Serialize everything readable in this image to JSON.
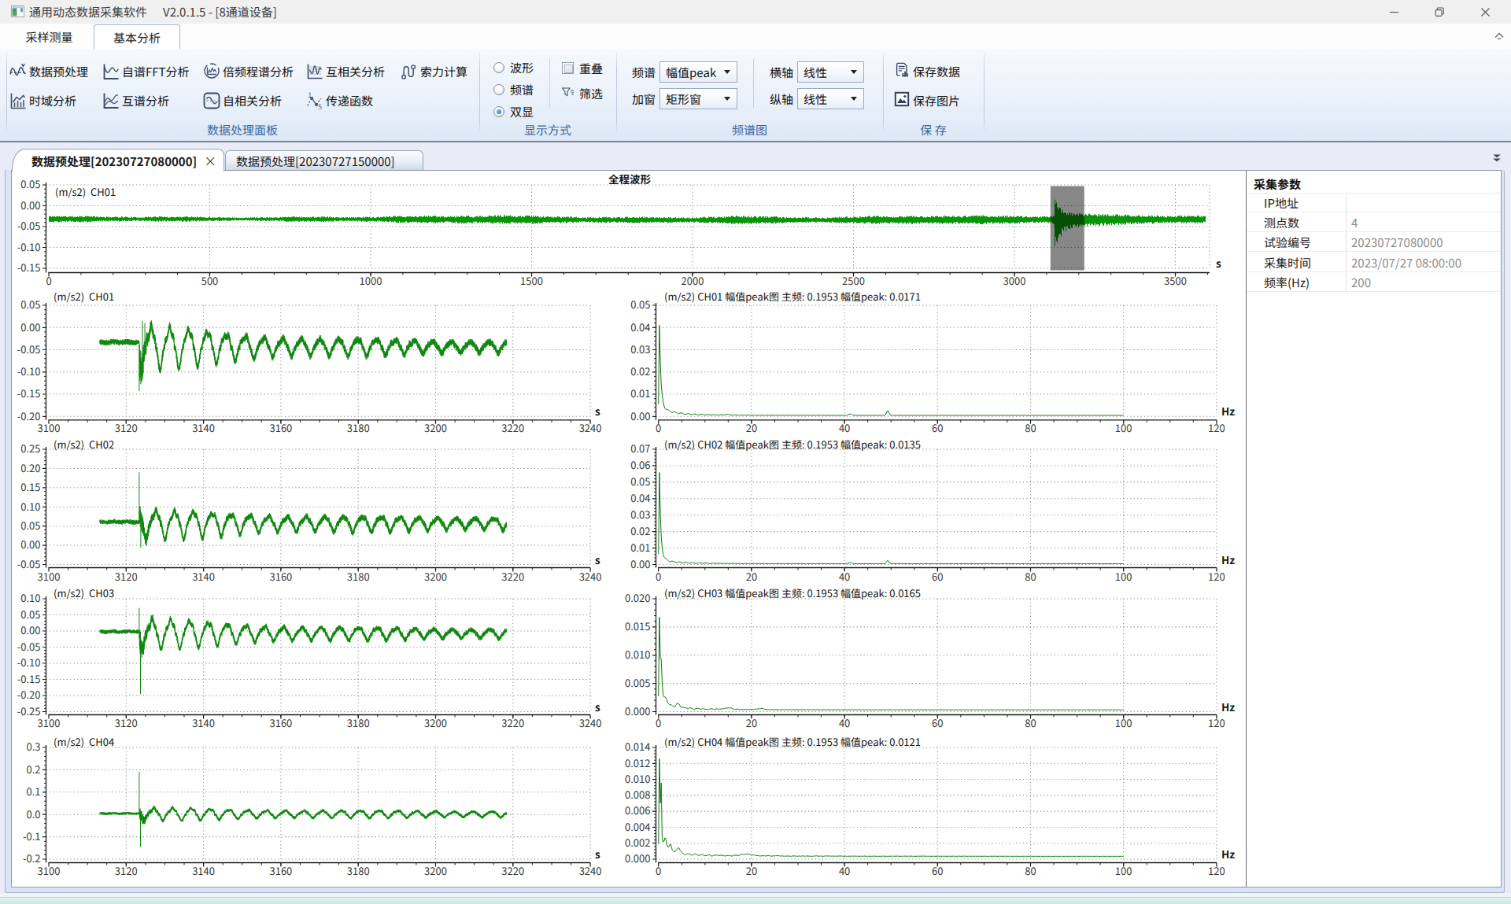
{
  "window": {
    "icon": "app-window-icon",
    "title": "通用动态数据采集软件",
    "version": "V2.0.1.5 - [8通道设备]",
    "buttons": [
      "minimize",
      "restore",
      "close"
    ]
  },
  "ribbon": {
    "tabs": [
      {
        "label": "采样测量",
        "active": false
      },
      {
        "label": "基本分析",
        "active": true
      }
    ],
    "groups": [
      {
        "label": "数据处理面板",
        "buttons": [
          {
            "id": "preprocess",
            "icon": "wave-check-icon",
            "label": "数据预处理"
          },
          {
            "id": "fft",
            "icon": "spectrum-curve-icon",
            "label": "自谱FFT分析"
          },
          {
            "id": "octave",
            "icon": "circle-histogram-icon",
            "label": "倍频程谱分析"
          },
          {
            "id": "xcorr",
            "icon": "dual-wave-chart-icon",
            "label": "互相关分析"
          },
          {
            "id": "cable-force",
            "icon": "rope-ends-icon",
            "label": "索力计算"
          },
          {
            "id": "time-domain",
            "icon": "bar-line-chart-icon",
            "label": "时域分析"
          },
          {
            "id": "cross-spectrum",
            "icon": "two-curves-icon",
            "label": "互谱分析"
          },
          {
            "id": "autocorr",
            "icon": "boxed-wave-icon",
            "label": "自相关分析"
          },
          {
            "id": "transfer-fn",
            "icon": "node-zigzag-icon",
            "label": "传递函数"
          }
        ]
      },
      {
        "label": "显示方式",
        "radios": [
          {
            "label": "波形",
            "checked": false
          },
          {
            "label": "频谱",
            "checked": false
          },
          {
            "label": "双显",
            "checked": true
          }
        ],
        "checkbox": {
          "label": "重叠",
          "checked": false
        },
        "filter": {
          "label": "筛选",
          "icon": "funnel-icon"
        }
      },
      {
        "label": "频谱图",
        "fields": [
          {
            "label": "频谱",
            "value": "幅值peak"
          },
          {
            "label": "加窗",
            "value": "矩形窗"
          },
          {
            "label": "横轴",
            "value": "线性"
          },
          {
            "label": "纵轴",
            "value": "线性"
          }
        ]
      },
      {
        "label": "保 存",
        "buttons": [
          {
            "id": "save-data",
            "icon": "document-chart-icon",
            "label": "保存数据"
          },
          {
            "id": "save-image",
            "icon": "picture-icon",
            "label": "保存图片"
          }
        ]
      }
    ]
  },
  "doc_tabs": [
    {
      "label": "数据预处理[20230727080000]",
      "active": true,
      "close": "×"
    },
    {
      "label": "数据预处理[20230727150000]",
      "active": false
    }
  ],
  "params": {
    "title": "采集参数",
    "rows": [
      {
        "label": "IP地址",
        "value": ""
      },
      {
        "label": "测点数",
        "value": "4"
      },
      {
        "label": "试验编号",
        "value": "20230727080000"
      },
      {
        "label": "采集时间",
        "value": "2023/07/27 08:00:00"
      },
      {
        "label": "频率(Hz)",
        "value": "200"
      }
    ]
  },
  "chart_data": {
    "overview": {
      "type": "line",
      "title": "全程波形",
      "unit": "(m/s2)",
      "channel": "CH01",
      "xlabel": "s",
      "x_ticks": [
        "0",
        "500",
        "1000",
        "1500",
        "2000",
        "2500",
        "3000",
        "3500"
      ],
      "x_tick_values": [
        0,
        500,
        1000,
        1500,
        2000,
        2500,
        3000,
        3500
      ],
      "y_ticks": [
        "0.05",
        "0.00",
        "-0.05",
        "-0.10",
        "-0.15"
      ],
      "y_tick_values": [
        0.05,
        0.0,
        -0.05,
        -0.1,
        -0.15
      ],
      "x_range_data": [
        0,
        3592
      ],
      "selection": [
        3112,
        3217
      ],
      "signal": {
        "seed": 11,
        "base": -0.033,
        "noise": 0.005,
        "event_t": 3122.5,
        "event_amp": 0.053,
        "event_tau": 21,
        "post_amp": 0.009,
        "post_tau": 320,
        "bumps": [
          {
            "t": 2130,
            "a": 0.0032,
            "w": 110
          },
          {
            "t": 1350,
            "a": 0.0018,
            "w": 140
          },
          {
            "t": 2750,
            "a": 0.0015,
            "w": 90
          }
        ]
      }
    },
    "time_series": [
      {
        "type": "line",
        "unit": "(m/s2)",
        "channel": "CH01",
        "xlabel": "s",
        "x_ticks": [
          "3100",
          "3120",
          "3140",
          "3160",
          "3180",
          "3200",
          "3220",
          "3240"
        ],
        "x_tick_values": [
          3100,
          3120,
          3140,
          3160,
          3180,
          3200,
          3220,
          3240
        ],
        "y_ticks": [
          "0.05",
          "0.00",
          "-0.05",
          "-0.10",
          "-0.15",
          "-0.20"
        ],
        "y_tick_values": [
          0.05,
          0.0,
          -0.05,
          -0.1,
          -0.15,
          -0.2
        ],
        "signal": {
          "seed": 21,
          "base": -0.033,
          "mid": -0.0435,
          "noise_pre": 0.0052,
          "noise_post": 0.0062,
          "burst": 0.03,
          "up0": 0.027,
          "up1": 0.0095,
          "tau": 38,
          "asym": 1.32,
          "freq": 0.206,
          "phi": 2.4,
          "spikes": [
            [
              0.0,
              -0.143
            ],
            [
              0.85,
              0.015
            ],
            [
              1.45,
              0.01
            ]
          ]
        }
      },
      {
        "type": "line",
        "unit": "(m/s2)",
        "channel": "CH02",
        "xlabel": "s",
        "x_ticks": [
          "3100",
          "3120",
          "3140",
          "3160",
          "3180",
          "3200",
          "3220",
          "3240"
        ],
        "x_tick_values": [
          3100,
          3120,
          3140,
          3160,
          3180,
          3200,
          3220,
          3240
        ],
        "y_ticks": [
          "0.25",
          "0.20",
          "0.15",
          "0.10",
          "0.05",
          "0.00",
          "-0.05"
        ],
        "y_tick_values": [
          0.25,
          0.2,
          0.15,
          0.1,
          0.05,
          0.0,
          -0.05
        ],
        "signal": {
          "seed": 22,
          "base": 0.061,
          "mid": 0.0575,
          "noise_pre": 0.005,
          "noise_post": 0.006,
          "burst": 0.02,
          "up0": 0.014,
          "up1": 0.0122,
          "tau": 40,
          "asym": 1.5,
          "freq": 0.206,
          "phi": 0.8,
          "spikes": [
            [
              0.0,
              0.19
            ],
            [
              0.4,
              -0.006
            ]
          ]
        }
      },
      {
        "type": "line",
        "unit": "(m/s2)",
        "channel": "CH03",
        "xlabel": "s",
        "x_ticks": [
          "3100",
          "3120",
          "3140",
          "3160",
          "3180",
          "3200",
          "3220",
          "3240"
        ],
        "x_tick_values": [
          3100,
          3120,
          3140,
          3160,
          3180,
          3200,
          3220,
          3240
        ],
        "y_ticks": [
          "0.10",
          "0.05",
          "0.00",
          "-0.05",
          "-0.10",
          "-0.15",
          "-0.20",
          "-0.25"
        ],
        "y_tick_values": [
          0.1,
          0.05,
          0.0,
          -0.05,
          -0.1,
          -0.15,
          -0.2,
          -0.25
        ],
        "signal": {
          "seed": 23,
          "base": -0.002,
          "mid": -0.008,
          "noise_pre": 0.005,
          "noise_post": 0.006,
          "burst": 0.028,
          "up0": 0.025,
          "up1": 0.011,
          "tau": 42,
          "asym": 1.25,
          "freq": 0.206,
          "phi": 2.1,
          "spikes": [
            [
              0.0,
              0.072
            ],
            [
              0.35,
              -0.195
            ]
          ]
        }
      },
      {
        "type": "line",
        "unit": "(m/s2)",
        "channel": "CH04",
        "xlabel": "s",
        "x_ticks": [
          "3100",
          "3120",
          "3140",
          "3160",
          "3180",
          "3200",
          "3220",
          "3240"
        ],
        "x_tick_values": [
          3100,
          3120,
          3140,
          3160,
          3180,
          3200,
          3220,
          3240
        ],
        "y_ticks": [
          "0.3",
          "0.2",
          "0.1",
          "0.0",
          "-0.1",
          "-0.2"
        ],
        "y_tick_values": [
          0.3,
          0.2,
          0.1,
          0.0,
          -0.1,
          -0.2
        ],
        "signal": {
          "seed": 24,
          "base": 0.0045,
          "mid": 0.001,
          "noise_pre": 0.0046,
          "noise_post": 0.0052,
          "burst": 0.022,
          "up0": 0.011,
          "up1": 0.011,
          "tau": 60,
          "asym": 1.15,
          "freq": 0.206,
          "phi": 1.5,
          "spikes": [
            [
              0.0,
              0.19
            ],
            [
              0.35,
              -0.145
            ]
          ]
        }
      }
    ],
    "spectra": [
      {
        "type": "line",
        "unit": "(m/s2)",
        "channel": "CH01",
        "title_rest": "幅值peak图 主频: 0.1953 幅值peak: 0.0171",
        "xlabel": "Hz",
        "x_ticks": [
          "0",
          "20",
          "40",
          "60",
          "80",
          "100",
          "120"
        ],
        "x_tick_values": [
          0,
          20,
          40,
          60,
          80,
          100,
          120
        ],
        "y_ticks": [
          "0.05",
          "0.04",
          "0.03",
          "0.02",
          "0.01",
          "0.00"
        ],
        "y_tick_values": [
          0.05,
          0.04,
          0.03,
          0.02,
          0.01,
          0.0
        ],
        "main_freq": 0.1953,
        "peak_value": 0.0171,
        "signal": {
          "seed": 31,
          "p1": 0.037,
          "d1": 0.32,
          "p2": 0.0035,
          "d2": 2.2,
          "floor": 0.00045,
          "wamp": 0.0011,
          "bumps": [
            {
              "f": 41.2,
              "a": 0.0006,
              "w": 0.5
            },
            {
              "f": 49.3,
              "a": 0.0021,
              "w": 0.35
            },
            {
              "f": 14.8,
              "a": 0.0003,
              "w": 0.6
            }
          ]
        }
      },
      {
        "type": "line",
        "unit": "(m/s2)",
        "channel": "CH02",
        "title_rest": "幅值peak图 主频: 0.1953 幅值peak: 0.0135",
        "xlabel": "Hz",
        "x_ticks": [
          "0",
          "20",
          "40",
          "60",
          "80",
          "100",
          "120"
        ],
        "x_tick_values": [
          0,
          20,
          40,
          60,
          80,
          100,
          120
        ],
        "y_ticks": [
          "0.07",
          "0.06",
          "0.05",
          "0.04",
          "0.03",
          "0.02",
          "0.01",
          "0.00"
        ],
        "y_tick_values": [
          0.07,
          0.06,
          0.05,
          0.04,
          0.03,
          0.02,
          0.01,
          0.0
        ],
        "main_freq": 0.1953,
        "peak_value": 0.0135,
        "signal": {
          "seed": 32,
          "p1": 0.052,
          "d1": 0.3,
          "p2": 0.003,
          "d2": 2.0,
          "floor": 0.00045,
          "wamp": 0.0012,
          "bumps": [
            {
              "f": 41.2,
              "a": 0.0007,
              "w": 0.5
            },
            {
              "f": 49.3,
              "a": 0.002,
              "w": 0.35
            }
          ]
        }
      },
      {
        "type": "line",
        "unit": "(m/s2)",
        "channel": "CH03",
        "title_rest": "幅值peak图 主频: 0.1953 幅值peak: 0.0165",
        "xlabel": "Hz",
        "x_ticks": [
          "0",
          "20",
          "40",
          "60",
          "80",
          "100",
          "120"
        ],
        "x_tick_values": [
          0,
          20,
          40,
          60,
          80,
          100,
          120
        ],
        "y_ticks": [
          "0.020",
          "0.015",
          "0.010",
          "0.005",
          "0.000"
        ],
        "y_tick_values": [
          0.02,
          0.015,
          0.01,
          0.005,
          0.0
        ],
        "main_freq": 0.1953,
        "peak_value": 0.0165,
        "signal": {
          "seed": 33,
          "p1": 0.0149,
          "d1": 0.3,
          "p2": 0.0014,
          "d2": 2.4,
          "floor": 0.0003,
          "wamp": 0.0004,
          "second": {
            "f": 0.66,
            "a": 0.0048,
            "w": 0.13
          },
          "bumps": [
            {
              "f": 1.6,
              "a": 0.0009,
              "w": 0.5
            },
            {
              "f": 4.2,
              "a": 0.0006,
              "w": 0.6
            },
            {
              "f": 15,
              "a": 0.00025,
              "w": 1.2
            },
            {
              "f": 22,
              "a": 0.0002,
              "w": 1.0
            }
          ]
        }
      },
      {
        "type": "line",
        "unit": "(m/s2)",
        "channel": "CH04",
        "title_rest": "幅值peak图 主频: 0.1953 幅值peak: 0.0121",
        "xlabel": "Hz",
        "x_ticks": [
          "0",
          "20",
          "40",
          "60",
          "80",
          "100",
          "120"
        ],
        "x_tick_values": [
          0,
          20,
          40,
          60,
          80,
          100,
          120
        ],
        "y_ticks": [
          "0.014",
          "0.012",
          "0.010",
          "0.008",
          "0.006",
          "0.004",
          "0.002",
          "0.000"
        ],
        "y_tick_values": [
          0.014,
          0.012,
          0.01,
          0.008,
          0.006,
          0.004,
          0.002,
          0.0
        ],
        "main_freq": 0.1953,
        "peak_value": 0.0121,
        "signal": {
          "seed": 34,
          "p1": 0.0112,
          "d1": 0.26,
          "p2": 0.001,
          "d2": 2.2,
          "floor": 0.00035,
          "wamp": 0.0004,
          "second": {
            "f": 0.58,
            "a": 0.0058,
            "w": 0.11
          },
          "bumps": [
            {
              "f": 1.5,
              "a": 0.0016,
              "w": 0.35
            },
            {
              "f": 2.6,
              "a": 0.001,
              "w": 0.4
            },
            {
              "f": 4.3,
              "a": 0.0008,
              "w": 0.5
            },
            {
              "f": 19,
              "a": 0.0002,
              "w": 1.5
            }
          ]
        }
      }
    ]
  }
}
